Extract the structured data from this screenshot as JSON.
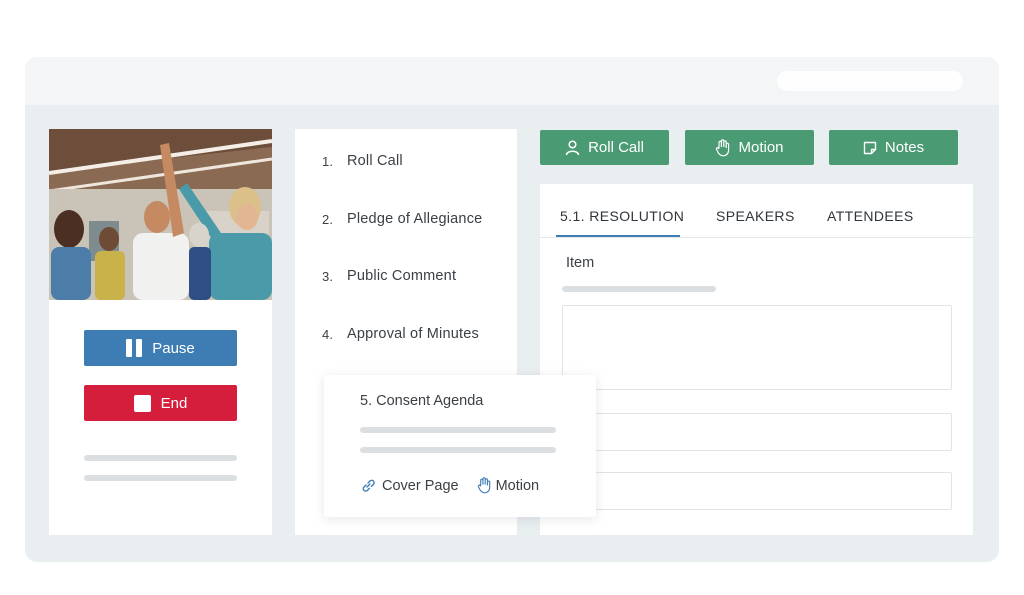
{
  "controls": {
    "pause_label": "Pause",
    "end_label": "End"
  },
  "agenda": {
    "items": [
      {
        "number": "1.",
        "label": "Roll Call"
      },
      {
        "number": "2.",
        "label": "Pledge of Allegiance"
      },
      {
        "number": "3.",
        "label": "Public Comment"
      },
      {
        "number": "4.",
        "label": "Approval of Minutes"
      }
    ],
    "popup": {
      "title": "5. Consent Agenda",
      "cover_page_label": "Cover Page",
      "motion_label": "Motion"
    }
  },
  "actions": {
    "roll_call_label": "Roll Call",
    "motion_label": "Motion",
    "notes_label": "Notes"
  },
  "detail": {
    "tabs": [
      "5.1. RESOLUTION",
      "SPEAKERS",
      "ATTENDEES"
    ],
    "active_tab": "5.1. RESOLUTION",
    "item_label": "Item"
  },
  "colors": {
    "pause": "#3e7db4",
    "end": "#d51d3c",
    "action": "#4a9a74",
    "active_tab_underline": "#3e7db4"
  },
  "icons": {
    "roll_call": "person-icon",
    "motion": "raised-hand-icon",
    "notes": "note-icon",
    "cover_page": "link-icon"
  }
}
